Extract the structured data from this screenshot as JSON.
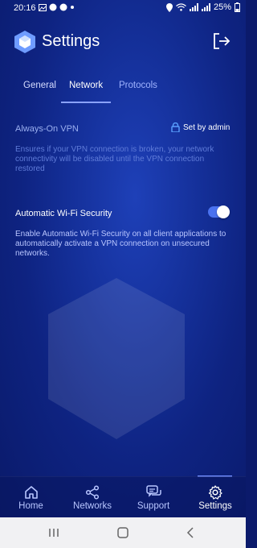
{
  "status_bar": {
    "time": "20:16",
    "battery": "25%"
  },
  "header": {
    "title": "Settings",
    "logo_icon": "app-logo-icon",
    "logout_icon": "logout-icon"
  },
  "tabs": [
    {
      "label": "General"
    },
    {
      "label": "Network",
      "active": true
    },
    {
      "label": "Protocols"
    }
  ],
  "always_on_vpn": {
    "title": "Always-On VPN",
    "admin_label": "Set by admin",
    "description": "Ensures if your VPN connection is broken, your network connectivity will be disabled until the VPN connection restored"
  },
  "wifi_security": {
    "title": "Automatic Wi-Fi Security",
    "enabled": true,
    "description": "Enable Automatic Wi-Fi Security on all client applications to automatically activate a VPN connection on unsecured networks."
  },
  "bottom_nav": [
    {
      "label": "Home",
      "icon": "home-icon"
    },
    {
      "label": "Networks",
      "icon": "share-icon"
    },
    {
      "label": "Support",
      "icon": "chat-icon"
    },
    {
      "label": "Settings",
      "icon": "gear-icon",
      "active": true
    }
  ],
  "colors": {
    "background": "#142f98",
    "accent": "#4a72f0",
    "active_tab_underline": "#8aa2ff"
  }
}
